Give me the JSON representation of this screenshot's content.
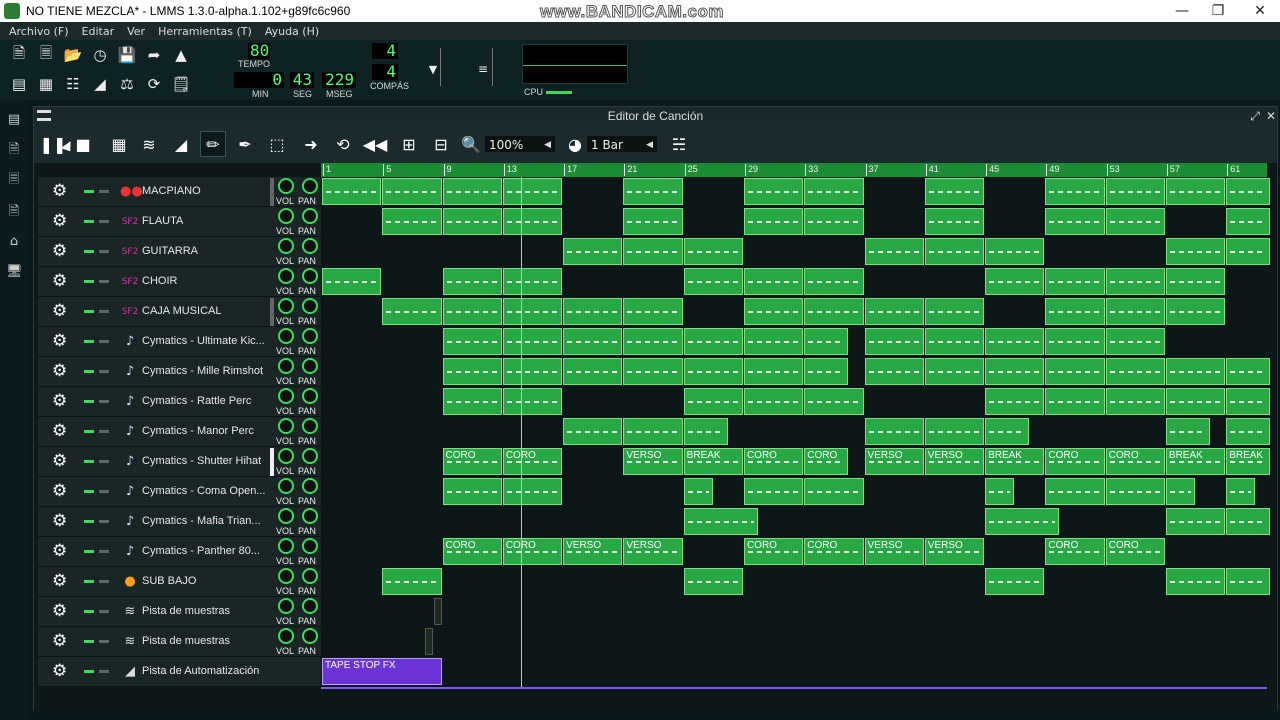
{
  "window": {
    "title": "NO TIENE MEZCLA* - LMMS 1.3.0-alpha.1.102+g89fc6c960",
    "watermark": "www.BANDICAM.com",
    "minimize": "—",
    "maximize": "❐",
    "close": "✕"
  },
  "menubar": {
    "items": [
      "Archivo (F)",
      "Editar",
      "Ver",
      "Herramientas (T)",
      "Ayuda (H)"
    ]
  },
  "transport": {
    "tempo_value": "80",
    "tempo_label": "TEMPO",
    "min_value": "0",
    "min_label": "MIN",
    "sec_value": "43",
    "sec_label": "SEG",
    "msec_value": "229",
    "msec_label": "MSEG",
    "ts_num": "4",
    "ts_den": "4",
    "ts_label": "COMPÁS",
    "cpu_label": "CPU"
  },
  "song_editor": {
    "title": "Editor de Canción",
    "zoom": "100%",
    "quantize": "1 Bar",
    "timeline_bars": [
      "1",
      "5",
      "9",
      "13",
      "17",
      "21",
      "25",
      "29",
      "33",
      "37",
      "41",
      "45",
      "49",
      "53",
      "57",
      "61"
    ],
    "playhead_bar": 14.3,
    "vol_label": "VOL",
    "pan_label": "PAN"
  },
  "tracks": [
    {
      "name": "MACPIANO",
      "type": "instrument",
      "icon": "macpiano-icon"
    },
    {
      "name": "FLAUTA",
      "type": "instrument",
      "icon": "sf2-icon"
    },
    {
      "name": "GUITARRA",
      "type": "instrument",
      "icon": "sf2-icon"
    },
    {
      "name": "CHOIR",
      "type": "instrument",
      "icon": "sf2-icon"
    },
    {
      "name": "CAJA MUSICAL",
      "type": "instrument",
      "icon": "sf2-icon"
    },
    {
      "name": "Cymatics - Ultimate Kic...",
      "type": "instrument",
      "icon": "audiofile-icon"
    },
    {
      "name": "Cymatics - Mille Rimshot",
      "type": "instrument",
      "icon": "audiofile-icon"
    },
    {
      "name": "Cymatics - Rattle Perc",
      "type": "instrument",
      "icon": "audiofile-icon"
    },
    {
      "name": "Cymatics - Manor Perc",
      "type": "instrument",
      "icon": "audiofile-icon"
    },
    {
      "name": "Cymatics - Shutter Hihat",
      "type": "instrument",
      "icon": "audiofile-icon"
    },
    {
      "name": "Cymatics - Coma Open...",
      "type": "instrument",
      "icon": "audiofile-icon"
    },
    {
      "name": "Cymatics - Mafia Trian...",
      "type": "instrument",
      "icon": "audiofile-icon"
    },
    {
      "name": "Cymatics - Panther 80...",
      "type": "instrument",
      "icon": "audiofile-icon"
    },
    {
      "name": "SUB BAJO",
      "type": "instrument",
      "icon": "tripleoscillator-icon"
    },
    {
      "name": "Pista de muestras",
      "type": "sample",
      "icon": "waveform-icon"
    },
    {
      "name": "Pista de muestras",
      "type": "sample",
      "icon": "waveform-icon"
    },
    {
      "name": "Pista de Automatización",
      "type": "automation",
      "icon": "automation-icon"
    }
  ],
  "patterns": [
    [
      [
        1,
        4,
        ""
      ],
      [
        5,
        8,
        ""
      ],
      [
        9,
        12,
        ""
      ],
      [
        13,
        16,
        ""
      ],
      [
        21,
        24,
        ""
      ],
      [
        29,
        32,
        ""
      ],
      [
        33,
        36,
        ""
      ],
      [
        41,
        44,
        ""
      ],
      [
        49,
        52,
        ""
      ],
      [
        53,
        56,
        ""
      ],
      [
        57,
        60,
        ""
      ],
      [
        61,
        63,
        ""
      ]
    ],
    [
      [
        5,
        8,
        ""
      ],
      [
        9,
        12,
        ""
      ],
      [
        13,
        16,
        ""
      ],
      [
        21,
        24,
        ""
      ],
      [
        29,
        32,
        ""
      ],
      [
        33,
        36,
        ""
      ],
      [
        41,
        44,
        ""
      ],
      [
        49,
        52,
        ""
      ],
      [
        53,
        56,
        ""
      ],
      [
        61,
        63,
        ""
      ]
    ],
    [
      [
        17,
        20,
        ""
      ],
      [
        21,
        24,
        ""
      ],
      [
        25,
        28,
        ""
      ],
      [
        37,
        40,
        ""
      ],
      [
        41,
        44,
        ""
      ],
      [
        45,
        48,
        ""
      ],
      [
        57,
        60,
        ""
      ],
      [
        61,
        63,
        ""
      ]
    ],
    [
      [
        1,
        4,
        ""
      ],
      [
        9,
        12,
        ""
      ],
      [
        13,
        16,
        ""
      ],
      [
        25,
        28,
        ""
      ],
      [
        29,
        32,
        ""
      ],
      [
        33,
        36,
        ""
      ],
      [
        45,
        48,
        ""
      ],
      [
        49,
        52,
        ""
      ],
      [
        53,
        56,
        ""
      ],
      [
        57,
        60,
        ""
      ]
    ],
    [
      [
        5,
        8,
        ""
      ],
      [
        9,
        12,
        ""
      ],
      [
        13,
        16,
        ""
      ],
      [
        17,
        20,
        ""
      ],
      [
        21,
        24,
        ""
      ],
      [
        29,
        32,
        ""
      ],
      [
        33,
        36,
        ""
      ],
      [
        37,
        40,
        ""
      ],
      [
        41,
        44,
        ""
      ],
      [
        49,
        52,
        ""
      ],
      [
        53,
        56,
        ""
      ],
      [
        57,
        60,
        ""
      ]
    ],
    [
      [
        9,
        12,
        ""
      ],
      [
        13,
        16,
        ""
      ],
      [
        17,
        20,
        ""
      ],
      [
        21,
        24,
        ""
      ],
      [
        25,
        28,
        ""
      ],
      [
        29,
        32,
        ""
      ],
      [
        33,
        35,
        ""
      ],
      [
        37,
        40,
        ""
      ],
      [
        41,
        44,
        ""
      ],
      [
        45,
        48,
        ""
      ],
      [
        49,
        52,
        ""
      ],
      [
        53,
        56,
        ""
      ]
    ],
    [
      [
        9,
        12,
        ""
      ],
      [
        13,
        16,
        ""
      ],
      [
        17,
        20,
        ""
      ],
      [
        21,
        24,
        ""
      ],
      [
        25,
        28,
        ""
      ],
      [
        29,
        32,
        ""
      ],
      [
        33,
        35,
        ""
      ],
      [
        37,
        40,
        ""
      ],
      [
        41,
        44,
        ""
      ],
      [
        45,
        48,
        ""
      ],
      [
        49,
        52,
        ""
      ],
      [
        53,
        56,
        ""
      ],
      [
        57,
        60,
        ""
      ],
      [
        61,
        63,
        ""
      ]
    ],
    [
      [
        9,
        12,
        ""
      ],
      [
        13,
        16,
        ""
      ],
      [
        25,
        28,
        ""
      ],
      [
        29,
        32,
        ""
      ],
      [
        33,
        36,
        ""
      ],
      [
        45,
        48,
        ""
      ],
      [
        49,
        52,
        ""
      ],
      [
        53,
        56,
        ""
      ],
      [
        57,
        60,
        ""
      ],
      [
        61,
        63,
        ""
      ]
    ],
    [
      [
        17,
        20,
        ""
      ],
      [
        21,
        24,
        ""
      ],
      [
        25,
        27,
        ""
      ],
      [
        37,
        40,
        ""
      ],
      [
        41,
        44,
        ""
      ],
      [
        45,
        47,
        ""
      ],
      [
        57,
        59,
        ""
      ],
      [
        61,
        63,
        ""
      ]
    ],
    [
      [
        9,
        12,
        "CORO"
      ],
      [
        13,
        16,
        "CORO"
      ],
      [
        21,
        24,
        "VERSO"
      ],
      [
        25,
        28,
        "BREAK"
      ],
      [
        29,
        32,
        "CORO"
      ],
      [
        33,
        35,
        "CORO"
      ],
      [
        37,
        40,
        "VERSO"
      ],
      [
        41,
        44,
        "VERSO"
      ],
      [
        45,
        48,
        "BREAK"
      ],
      [
        49,
        52,
        "CORO"
      ],
      [
        53,
        56,
        "CORO"
      ],
      [
        57,
        60,
        "BREAK"
      ],
      [
        61,
        63,
        "BREAK"
      ]
    ],
    [
      [
        9,
        12,
        ""
      ],
      [
        13,
        16,
        ""
      ],
      [
        25,
        26,
        ""
      ],
      [
        29,
        32,
        ""
      ],
      [
        33,
        36,
        ""
      ],
      [
        45,
        46,
        ""
      ],
      [
        49,
        52,
        ""
      ],
      [
        53,
        56,
        ""
      ],
      [
        57,
        58,
        ""
      ],
      [
        61,
        62,
        ""
      ]
    ],
    [
      [
        25,
        29,
        ""
      ],
      [
        45,
        49,
        ""
      ],
      [
        57,
        60,
        ""
      ],
      [
        61,
        63,
        ""
      ]
    ],
    [
      [
        9,
        12,
        "CORO"
      ],
      [
        13,
        16,
        "CORO"
      ],
      [
        17,
        20,
        "VERSO"
      ],
      [
        21,
        24,
        "VERSO"
      ],
      [
        29,
        32,
        "CORO"
      ],
      [
        33,
        36,
        "CORO"
      ],
      [
        37,
        40,
        "VERSO"
      ],
      [
        41,
        44,
        "VERSO"
      ],
      [
        49,
        52,
        "CORO"
      ],
      [
        53,
        56,
        "CORO"
      ]
    ],
    [
      [
        5,
        8,
        ""
      ],
      [
        25,
        28,
        ""
      ],
      [
        45,
        48,
        ""
      ],
      [
        57,
        60,
        ""
      ],
      [
        61,
        63,
        ""
      ]
    ],
    [],
    [],
    [
      [
        1,
        8,
        "TAPE STOP FX"
      ]
    ]
  ]
}
